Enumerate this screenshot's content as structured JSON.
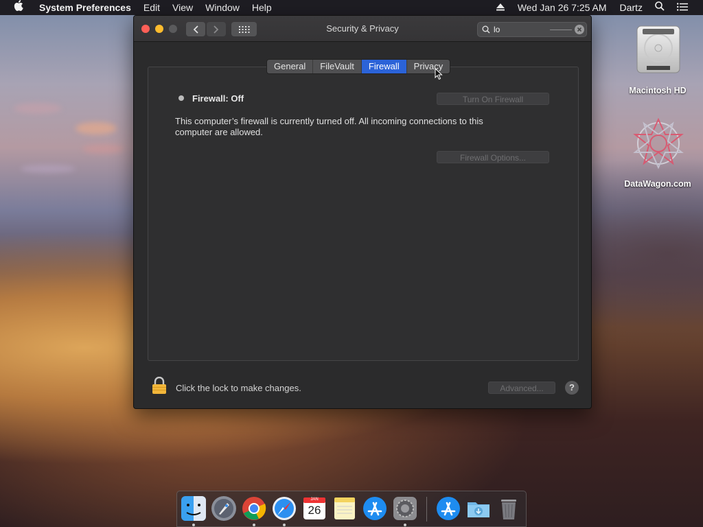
{
  "menubar": {
    "app_name": "System Preferences",
    "menus": [
      "Edit",
      "View",
      "Window",
      "Help"
    ],
    "clock": "Wed Jan 26  7:25 AM",
    "user": "Dartz",
    "icons": [
      "apple-icon",
      "eject-icon",
      "spotlight-search-icon",
      "notification-list-icon"
    ]
  },
  "window": {
    "title": "Security & Privacy",
    "search": {
      "value": "lo"
    },
    "tabs": [
      {
        "label": "General",
        "active": false
      },
      {
        "label": "FileVault",
        "active": false
      },
      {
        "label": "Firewall",
        "active": true
      },
      {
        "label": "Privacy",
        "active": false
      }
    ],
    "firewall": {
      "status": "Firewall: Off",
      "turn_on_button": "Turn On Firewall",
      "description": "This computer’s firewall is currently turned off. All incoming connections to this computer are allowed.",
      "options_button": "Firewall Options..."
    },
    "footer": {
      "lock_text": "Click the lock to make changes.",
      "advanced_button": "Advanced...",
      "help_label": "?"
    }
  },
  "desktop_icons": [
    {
      "label": "Macintosh HD",
      "icon": "hard-drive-icon"
    },
    {
      "label": "DataWagon.com",
      "icon": "datawagon-logo-icon"
    }
  ],
  "dock": {
    "apps": [
      "finder",
      "launchpad",
      "chrome",
      "safari",
      "calendar",
      "notes",
      "app-store",
      "system-preferences",
      "app-store-downloads",
      "downloads-folder",
      "trash"
    ],
    "calendar_month": "JAN",
    "calendar_day": "26"
  },
  "colors": {
    "accent": "#2b63d8",
    "window_bg": "#2b2b2c",
    "close": "#fe5f57",
    "minimize": "#febc2e"
  }
}
